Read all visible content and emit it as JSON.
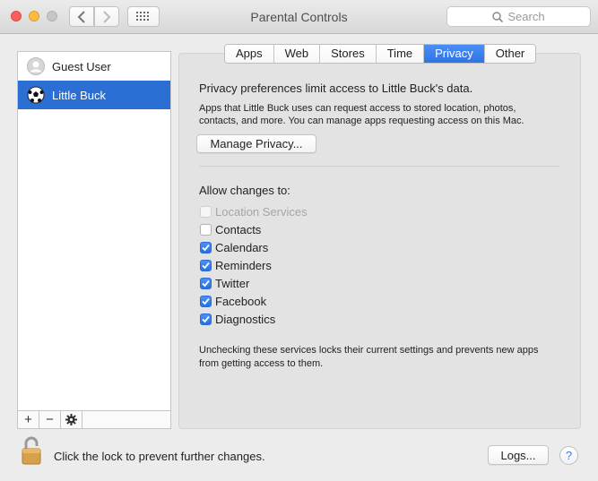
{
  "window": {
    "title": "Parental Controls",
    "search_placeholder": "Search"
  },
  "users": [
    {
      "name": "Guest User",
      "avatar_icon": "person-silhouette-icon",
      "selected": false
    },
    {
      "name": "Little Buck",
      "avatar_icon": "soccer-ball-icon",
      "selected": true
    }
  ],
  "list_toolbar": {
    "add": "+",
    "remove": "−",
    "actions_icon": "gear-icon"
  },
  "tabs": [
    {
      "label": "Apps",
      "active": false
    },
    {
      "label": "Web",
      "active": false
    },
    {
      "label": "Stores",
      "active": false
    },
    {
      "label": "Time",
      "active": false
    },
    {
      "label": "Privacy",
      "active": true
    },
    {
      "label": "Other",
      "active": false
    }
  ],
  "privacy": {
    "heading": "Privacy preferences limit access to Little Buck's data.",
    "description": "Apps that Little Buck uses can request access to stored location, photos, contacts, and more. You can manage apps requesting access on this Mac.",
    "manage_button": "Manage Privacy...",
    "allow_label": "Allow changes to:",
    "services": [
      {
        "label": "Location Services",
        "checked": false,
        "disabled": true
      },
      {
        "label": "Contacts",
        "checked": false,
        "disabled": false
      },
      {
        "label": "Calendars",
        "checked": true,
        "disabled": false
      },
      {
        "label": "Reminders",
        "checked": true,
        "disabled": false
      },
      {
        "label": "Twitter",
        "checked": true,
        "disabled": false
      },
      {
        "label": "Facebook",
        "checked": true,
        "disabled": false
      },
      {
        "label": "Diagnostics",
        "checked": true,
        "disabled": false
      }
    ],
    "footnote": "Unchecking these services locks their current settings and prevents new apps from getting access to them."
  },
  "footer": {
    "lock_text": "Click the lock to prevent further changes.",
    "logs_button": "Logs...",
    "help": "?"
  },
  "colors": {
    "selection_blue": "#2c6fd4",
    "checkbox_blue": "#2a6fe0",
    "close": "#fc605b",
    "minimize": "#fdbc40"
  }
}
